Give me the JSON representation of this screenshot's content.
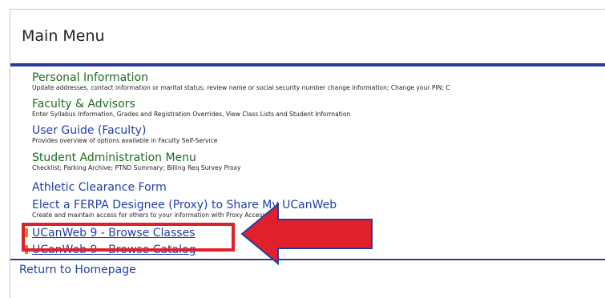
{
  "page": {
    "title": "Main Menu"
  },
  "menu": {
    "items": [
      {
        "title": "Personal Information",
        "desc": "Update addresses, contact information or marital status; review name or social security number change information; Change your PIN; C",
        "color": "green"
      },
      {
        "title": "Faculty & Advisors",
        "desc": "Enter Syllabus Information, Grades and Registration Overrides, View Class Lists and Student Information",
        "color": "green"
      },
      {
        "title": "User Guide (Faculty)",
        "desc": "Provides overview of options available in Faculty Self-Service",
        "color": "blue"
      },
      {
        "title": "Student Administration Menu",
        "desc": "Checklist; Parking Archive; PTND Summary; Billing Req Survey Proxy",
        "color": "green"
      },
      {
        "title": "Athletic Clearance Form",
        "desc": "",
        "color": "blue"
      },
      {
        "title": "Elect a FERPA Designee (Proxy) to Share My UCanWeb",
        "desc": "Create and maintain access for others to your information with Proxy Access.",
        "color": "blue"
      }
    ],
    "ucanweb": [
      {
        "label": "UCanWeb 9 - Browse Classes"
      },
      {
        "label": "UCanWeb 9 - Browse Catalog"
      }
    ]
  },
  "footer": {
    "return_label": "Return to Homepage"
  },
  "colors": {
    "accent_rule": "#2a3a9a",
    "link_blue": "#1f3fa8",
    "link_green": "#1f6b1f",
    "highlight_red": "#e0202a",
    "marker_orange": "#e07a20"
  },
  "annotation": {
    "type": "highlight-box-with-arrow"
  }
}
